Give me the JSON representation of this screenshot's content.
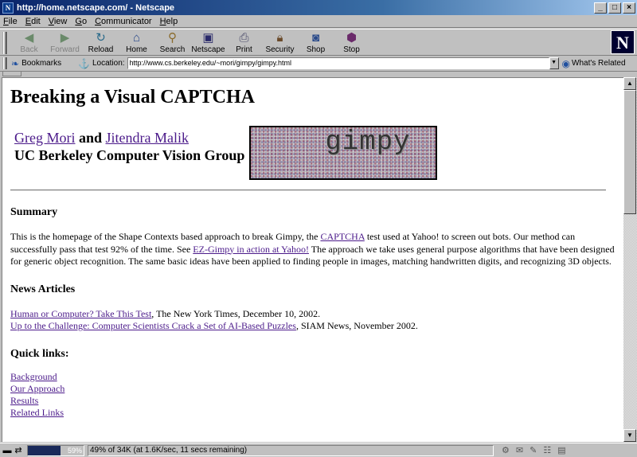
{
  "window": {
    "title": "http://home.netscape.com/ - Netscape",
    "buttons": [
      "_",
      "□",
      "×"
    ]
  },
  "menu": [
    "File",
    "Edit",
    "View",
    "Go",
    "Communicator",
    "Help"
  ],
  "toolbar": {
    "back": "Back",
    "forward": "Forward",
    "reload": "Reload",
    "home": "Home",
    "search": "Search",
    "netscape": "Netscape",
    "print": "Print",
    "security": "Security",
    "shop": "Shop",
    "stop": "Stop",
    "logo": "N"
  },
  "location": {
    "bookmarks": "Bookmarks",
    "label": "Location:",
    "url": "http://www.cs.berkeley.edu/~mori/gimpy/gimpy.html",
    "related": "What's Related"
  },
  "page": {
    "title": "Breaking a Visual CAPTCHA",
    "author1": "Greg Mori",
    "and": "and",
    "author2": "Jitendra Malik",
    "group": "UC Berkeley Computer Vision Group",
    "captcha_word": "gimpy",
    "summary_heading": "Summary",
    "summary_1": "This is the homepage of the Shape Contexts based approach to break Gimpy, the ",
    "summary_link1": "CAPTCHA",
    "summary_2": " test used at Yahoo! to screen out bots. Our method can successfully pass that test 92% of the time. See ",
    "summary_link2": "EZ-Gimpy in action at Yahoo!",
    "summary_3": " The approach we take uses general purpose algorithms that have been designed for generic object recognition. The same basic ideas have been applied to finding people in images, matching handwritten digits, and recognizing 3D objects.",
    "news_heading": "News Articles",
    "news1_link": "Human or Computer? Take This Test",
    "news1_rest": ", The New York Times, December 10, 2002.",
    "news2_link": "Up to the Challenge: Computer Scientists Crack a Set of AI-Based Puzzles",
    "news2_rest": ", SIAM News, November 2002.",
    "quick_heading": "Quick links:",
    "quick_links": [
      "Background",
      "Our Approach",
      "Results",
      "Related Links"
    ]
  },
  "status": {
    "progress_percent": 59,
    "progress_label": "59%",
    "text": "49% of 34K (at 1.6K/sec, 11 secs remaining)"
  },
  "colors": {
    "link": "#4b1a8a",
    "titlebar": "#0a246a"
  }
}
